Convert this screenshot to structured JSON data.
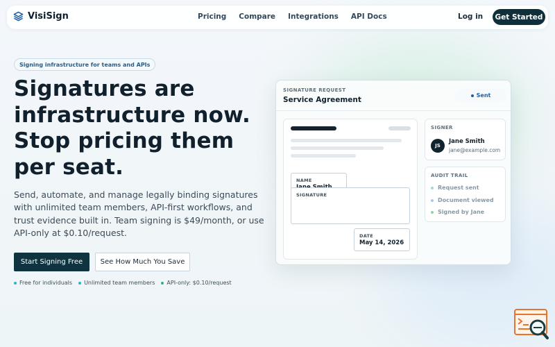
{
  "brand": {
    "name": "VisiSign"
  },
  "nav": {
    "links": [
      "Pricing",
      "Compare",
      "Integrations",
      "API Docs"
    ],
    "login": "Log in",
    "cta": "Get Started"
  },
  "hero": {
    "pill": "Signing infrastructure for teams and APIs",
    "headline": "Signatures are infrastructure now. Stop pricing them per seat.",
    "subcopy": "Send, automate, and manage legally binding signatures with unlimited team members, API-first workflows, and trust evidence built in. Team signing is $49/month, or use API-only at $0.10/request.",
    "primary_button": "Start Signing Free",
    "secondary_button": "See How Much You Save",
    "features": [
      {
        "label": "Free for individuals",
        "color": "#2bb3c9"
      },
      {
        "label": "Unlimited team members",
        "color": "#2bb3c9"
      },
      {
        "label": "API-only: $0.10/request",
        "color": "#34b27b"
      }
    ]
  },
  "preview": {
    "request_label": "SIGNATURE REQUEST",
    "title": "Service Agreement",
    "status": "Sent",
    "fields": {
      "name_label": "NAME",
      "name_value": "Jane Smith",
      "signature_label": "SIGNATURE",
      "date_label": "DATE",
      "date_value": "May 14, 2026"
    },
    "signer": {
      "label": "SIGNER",
      "initials": "JS",
      "name": "Jane Smith",
      "email": "jane@example.com"
    },
    "audit": {
      "label": "AUDIT TRAIL",
      "items": [
        {
          "label": "Request sent",
          "color": "#9fd8df"
        },
        {
          "label": "Document viewed",
          "color": "#a9c7ec"
        },
        {
          "label": "Signed by Jane",
          "color": "#8fd4a8"
        }
      ]
    }
  },
  "colors": {
    "accent": "#0f3440",
    "status_blue": "#1d5fa0",
    "widget_orange": "#e8742c"
  }
}
